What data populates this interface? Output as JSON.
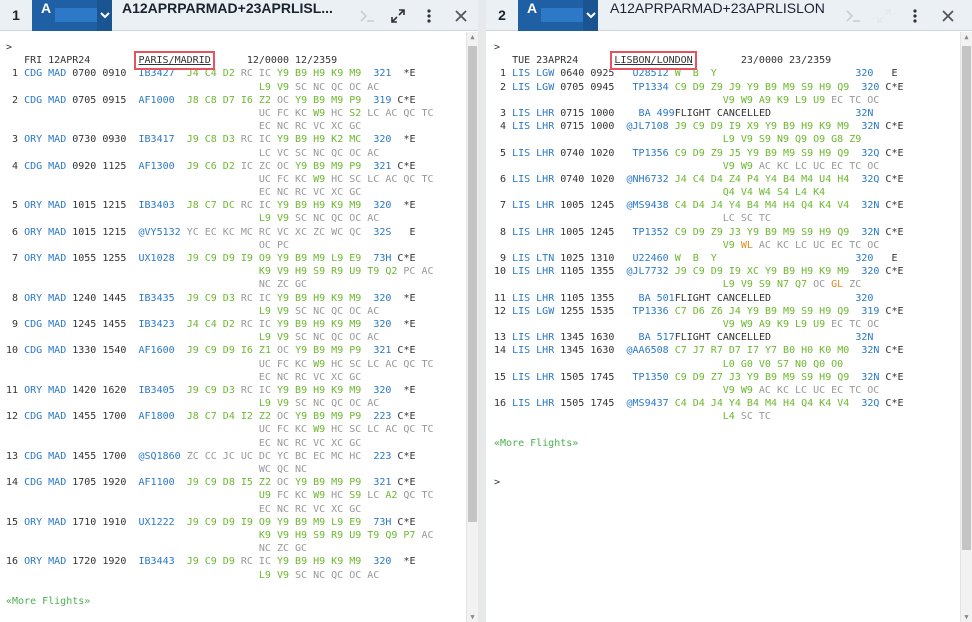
{
  "pane1": {
    "tab_number": "1",
    "agent_letter": "A",
    "title": "A12APRPARMAD+23APRLISL...",
    "header": "FRI 12APR24",
    "citypair": "PARIS/MADRID",
    "time_range": "12/0000 12/2359",
    "prompt": ">",
    "more": "«More Flights»",
    "rows": [
      {
        "l": " 1 ",
        "from": "CDG",
        "to": "MAD",
        "dep": "0700",
        "arr": "0910",
        "fl": "IB3427",
        "c1": "J4 C4 D2 ",
        "c2": "RC IC ",
        "c3": "Y9 B9 H9 K9 M9 ",
        "eq": "321",
        "tail": "  *E"
      },
      {
        "l": "",
        "cont": "L9 V9 SC NC QC OC AC"
      },
      {
        "l": " 2 ",
        "from": "CDG",
        "to": "MAD",
        "dep": "0705",
        "arr": "0915",
        "fl": "AF1000",
        "c1": "J8 C8 D7 I6 Z2 ",
        "c2": "OC ",
        "c3": "Y9 B9 M9 P9 ",
        "eq": "319",
        "tail": " C*E"
      },
      {
        "l": "",
        "cont": "UC FC KC W9 HC S2 LC AC QC TC"
      },
      {
        "l": "",
        "cont": "EC NC RC VC XC GC"
      },
      {
        "l": " 3 ",
        "from": "ORY",
        "to": "MAD",
        "dep": "0730",
        "arr": "0930",
        "fl": "IB3417",
        "c1": "J9 C8 D3 ",
        "c2": "RC IC ",
        "c3": "Y9 B9 H9 K2 MC ",
        "eq": "320",
        "tail": "  *E"
      },
      {
        "l": "",
        "cont": "LC VC SC NC QC OC AC"
      },
      {
        "l": " 4 ",
        "from": "CDG",
        "to": "MAD",
        "dep": "0920",
        "arr": "1125",
        "fl": "AF1300",
        "c1": "J9 C6 D2 ",
        "c2": "IC ZC OC ",
        "c3": "Y9 B9 M9 P9 ",
        "eq": "321",
        "tail": " C*E"
      },
      {
        "l": "",
        "cont": "UC FC KC W9 HC SC LC AC QC TC"
      },
      {
        "l": "",
        "cont": "EC NC RC VC XC GC"
      },
      {
        "l": " 5 ",
        "from": "ORY",
        "to": "MAD",
        "dep": "1015",
        "arr": "1215",
        "fl": "IB3403",
        "c1": "J8 C7 DC ",
        "c2": "RC IC ",
        "c3": "Y9 B9 H9 K9 M9 ",
        "eq": "320",
        "tail": "  *E"
      },
      {
        "l": "",
        "cont": "L9 V9 SC NC QC OC AC"
      },
      {
        "l": " 6 ",
        "from": "ORY",
        "to": "MAD",
        "dep": "1015",
        "arr": "1215",
        "fl": "@VY5132",
        "c1": "",
        "c2": "YC EC KC MC RC VC XC ZC WC QC ",
        "c3": "",
        "eq": "32S",
        "tail": "   E"
      },
      {
        "l": "",
        "cont": "OC PC"
      },
      {
        "l": " 7 ",
        "from": "ORY",
        "to": "MAD",
        "dep": "1055",
        "arr": "1255",
        "fl": "UX1028",
        "c1": "J9 C9 D9 I9 O9 ",
        "c2": "",
        "c3": "Y9 B9 M9 L9 E9 ",
        "eq": "73H",
        "tail": " C*E"
      },
      {
        "l": "",
        "cont": "K9 V9 H9 S9 R9 U9 T9 Q2 PC AC"
      },
      {
        "l": "",
        "cont": "NC ZC GC"
      },
      {
        "l": " 8 ",
        "from": "ORY",
        "to": "MAD",
        "dep": "1240",
        "arr": "1445",
        "fl": "IB3435",
        "c1": "J9 C9 D3 ",
        "c2": "RC IC ",
        "c3": "Y9 B9 H9 K9 M9 ",
        "eq": "320",
        "tail": "  *E"
      },
      {
        "l": "",
        "cont": "L9 V9 SC NC QC OC AC"
      },
      {
        "l": " 9 ",
        "from": "CDG",
        "to": "MAD",
        "dep": "1245",
        "arr": "1455",
        "fl": "IB3423",
        "c1": "J4 C4 D2 ",
        "c2": "RC IC ",
        "c3": "Y9 B9 H9 K9 M9 ",
        "eq": "320",
        "tail": "  *E"
      },
      {
        "l": "",
        "cont": "L9 V9 SC NC QC OC AC"
      },
      {
        "l": "10 ",
        "from": "CDG",
        "to": "MAD",
        "dep": "1330",
        "arr": "1540",
        "fl": "AF1600",
        "c1": "J9 C9 D9 I6 Z1 ",
        "c2": "OC ",
        "c3": "Y9 B9 M9 P9 ",
        "eq": "321",
        "tail": " C*E"
      },
      {
        "l": "",
        "cont": "UC FC KC W9 HC SC LC AC QC TC"
      },
      {
        "l": "",
        "cont": "EC NC RC VC XC GC"
      },
      {
        "l": "11 ",
        "from": "ORY",
        "to": "MAD",
        "dep": "1420",
        "arr": "1620",
        "fl": "IB3405",
        "c1": "J9 C9 D3 ",
        "c2": "RC IC ",
        "c3": "Y9 B9 H9 K9 M9 ",
        "eq": "320",
        "tail": "  *E"
      },
      {
        "l": "",
        "cont": "L9 V9 SC NC QC OC AC"
      },
      {
        "l": "12 ",
        "from": "CDG",
        "to": "MAD",
        "dep": "1455",
        "arr": "1700",
        "fl": "AF1800",
        "c1": "J8 C7 D4 I2 Z2 ",
        "c2": "OC ",
        "c3": "Y9 B9 M9 P9 ",
        "eq": "223",
        "tail": " C*E"
      },
      {
        "l": "",
        "cont": "UC FC KC W9 HC SC LC AC QC TC"
      },
      {
        "l": "",
        "cont": "EC NC RC VC XC GC"
      },
      {
        "l": "13 ",
        "from": "CDG",
        "to": "MAD",
        "dep": "1455",
        "arr": "1700",
        "fl": "@SQ1860",
        "c1": "",
        "c2": "ZC CC JC UC DC YC BC EC MC HC ",
        "c3": "",
        "eq": "223",
        "tail": " C*E"
      },
      {
        "l": "",
        "cont": "WC QC NC"
      },
      {
        "l": "14 ",
        "from": "CDG",
        "to": "MAD",
        "dep": "1705",
        "arr": "1920",
        "fl": "AF1100",
        "c1": "J9 C9 D8 I5 Z2 ",
        "c2": "OC ",
        "c3": "Y9 B9 M9 P9 ",
        "eq": "321",
        "tail": " C*E"
      },
      {
        "l": "",
        "cont": "U9 FC KC W9 HC S9 LC A2 QC TC"
      },
      {
        "l": "",
        "cont": "EC NC RC VC XC GC"
      },
      {
        "l": "15 ",
        "from": "ORY",
        "to": "MAD",
        "dep": "1710",
        "arr": "1910",
        "fl": "UX1222",
        "c1": "J9 C9 D9 I9 O9 ",
        "c2": "",
        "c3": "Y9 B9 M9 L9 E9 ",
        "eq": "73H",
        "tail": " C*E"
      },
      {
        "l": "",
        "cont": "K9 V9 H9 S9 R9 U9 T9 Q9 P7 AC"
      },
      {
        "l": "",
        "cont": "NC ZC GC"
      },
      {
        "l": "16 ",
        "from": "ORY",
        "to": "MAD",
        "dep": "1720",
        "arr": "1920",
        "fl": "IB3443",
        "c1": "J9 C9 D9 ",
        "c2": "RC IC ",
        "c3": "Y9 B9 H9 K9 M9 ",
        "eq": "320",
        "tail": "  *E"
      },
      {
        "l": "",
        "cont": "L9 V9 SC NC QC OC AC"
      }
    ]
  },
  "pane2": {
    "tab_number": "2",
    "agent_letter": "A",
    "title": "A12APRPARMAD+23APRLISLON",
    "header": "TUE 23APR24",
    "citypair": "LISBON/LONDON",
    "time_range": "23/0000 23/2359",
    "prompt": ">",
    "more": "«More Flights»",
    "rows": [
      {
        "l": " 1 ",
        "from": "LIS",
        "to": "LGW",
        "dep": "0640",
        "arr": "0925",
        "fl": " U28512",
        "c1": "W  B  Y",
        "c2": "",
        "c3": "",
        "eq": "320",
        "tail": "   E"
      },
      {
        "l": " 2 ",
        "from": "LIS",
        "to": "LGW",
        "dep": "0705",
        "arr": "0945",
        "fl": " TP1334",
        "c1": "C9 D9 Z9 J9 Y9 B9 M9 S9 H9 Q9 ",
        "c2": "",
        "c3": "",
        "eq": "320",
        "tail": " C*E"
      },
      {
        "l": "",
        "cont": "V9 W9 A9 K9 L9 U9 EC TC OC"
      },
      {
        "l": " 3 ",
        "from": "LIS",
        "to": "LHR",
        "dep": "0715",
        "arr": "1000",
        "fl": "  BA 499",
        "c1": "",
        "c2": "FLIGHT CANCELLED",
        "c3": "",
        "eq": "32N",
        "tail": ""
      },
      {
        "l": " 4 ",
        "from": "LIS",
        "to": "LHR",
        "dep": "0715",
        "arr": "1000",
        "fl": "@JL7108",
        "c1": "J9 C9 D9 I9 X9 Y9 B9 H9 K9 M9 ",
        "c2": "",
        "c3": "",
        "eq": "32N",
        "tail": " C*E"
      },
      {
        "l": "",
        "cont": "L9 V9 S9 N9 Q9 O9 G8 Z9"
      },
      {
        "l": " 5 ",
        "from": "LIS",
        "to": "LHR",
        "dep": "0740",
        "arr": "1020",
        "fl": " TP1356",
        "c1": "C9 D9 Z9 J5 Y9 B9 M9 S9 H9 Q9 ",
        "c2": "",
        "c3": "",
        "eq": "32Q",
        "tail": " C*E"
      },
      {
        "l": "",
        "cont": "V9 W9 AC KC LC UC EC TC OC"
      },
      {
        "l": " 6 ",
        "from": "LIS",
        "to": "LHR",
        "dep": "0740",
        "arr": "1020",
        "fl": "@NH6732",
        "c1": "J4 C4 D4 Z4 P4 Y4 B4 M4 U4 H4 ",
        "c2": "",
        "c3": "",
        "eq": "32Q",
        "tail": " C*E"
      },
      {
        "l": "",
        "cont": "Q4 V4 W4 S4 L4 K4"
      },
      {
        "l": " 7 ",
        "from": "LIS",
        "to": "LHR",
        "dep": "1005",
        "arr": "1245",
        "fl": "@MS9438",
        "c1": "C4 D4 J4 Y4 B4 M4 H4 Q4 K4 V4 ",
        "c2": "",
        "c3": "",
        "eq": "32N",
        "tail": " C*E"
      },
      {
        "l": "",
        "cont": "LC SC TC"
      },
      {
        "l": " 8 ",
        "from": "LIS",
        "to": "LHR",
        "dep": "1005",
        "arr": "1245",
        "fl": " TP1352",
        "c1": "C9 D9 Z9 J3 Y9 B9 M9 S9 H9 Q9 ",
        "c2": "",
        "c3": "",
        "eq": "32N",
        "tail": " C*E"
      },
      {
        "l": "",
        "cont": "V9 WL AC KC LC UC EC TC OC"
      },
      {
        "l": " 9 ",
        "from": "LIS",
        "to": "LTN",
        "dep": "1025",
        "arr": "1310",
        "fl": " U22460",
        "c1": "W  B  Y",
        "c2": "",
        "c3": "",
        "eq": "320",
        "tail": "   E"
      },
      {
        "l": "10 ",
        "from": "LIS",
        "to": "LHR",
        "dep": "1105",
        "arr": "1355",
        "fl": "@JL7732",
        "c1": "J9 C9 D9 I9 XC Y9 B9 H9 K9 M9 ",
        "c2": "",
        "c3": "",
        "eq": "320",
        "tail": " C*E"
      },
      {
        "l": "",
        "cont": "L9 V9 S9 N7 Q7 OC GL ZC"
      },
      {
        "l": "11 ",
        "from": "LIS",
        "to": "LHR",
        "dep": "1105",
        "arr": "1355",
        "fl": "  BA 501",
        "c1": "",
        "c2": "FLIGHT CANCELLED",
        "c3": "",
        "eq": "320",
        "tail": ""
      },
      {
        "l": "12 ",
        "from": "LIS",
        "to": "LGW",
        "dep": "1255",
        "arr": "1535",
        "fl": " TP1336",
        "c1": "C7 D6 Z6 J4 Y9 B9 M9 S9 H9 Q9 ",
        "c2": "",
        "c3": "",
        "eq": "319",
        "tail": " C*E"
      },
      {
        "l": "",
        "cont": "V9 W9 A9 K9 L9 U9 EC TC OC"
      },
      {
        "l": "13 ",
        "from": "LIS",
        "to": "LHR",
        "dep": "1345",
        "arr": "1630",
        "fl": "  BA 517",
        "c1": "",
        "c2": "FLIGHT CANCELLED",
        "c3": "",
        "eq": "32N",
        "tail": ""
      },
      {
        "l": "14 ",
        "from": "LIS",
        "to": "LHR",
        "dep": "1345",
        "arr": "1630",
        "fl": "@AA6508",
        "c1": "C7 J7 R7 D7 I7 Y7 B0 H0 K0 M0 ",
        "c2": "",
        "c3": "",
        "eq": "32N",
        "tail": " C*E"
      },
      {
        "l": "",
        "cont": "L0 G0 V0 S7 N0 Q0 O0"
      },
      {
        "l": "15 ",
        "from": "LIS",
        "to": "LHR",
        "dep": "1505",
        "arr": "1745",
        "fl": " TP1350",
        "c1": "C9 D9 Z7 J3 Y9 B9 M9 S9 H9 Q9 ",
        "c2": "",
        "c3": "",
        "eq": "32N",
        "tail": " C*E"
      },
      {
        "l": "",
        "cont": "V9 W9 AC KC LC UC EC TC OC"
      },
      {
        "l": "16 ",
        "from": "LIS",
        "to": "LHR",
        "dep": "1505",
        "arr": "1745",
        "fl": "@MS9437",
        "c1": "C4 D4 J4 Y4 B4 M4 H4 Q4 K4 V4 ",
        "c2": "",
        "c3": "",
        "eq": "32Q",
        "tail": " C*E"
      },
      {
        "l": "",
        "cont": "L4 SC TC"
      }
    ]
  }
}
